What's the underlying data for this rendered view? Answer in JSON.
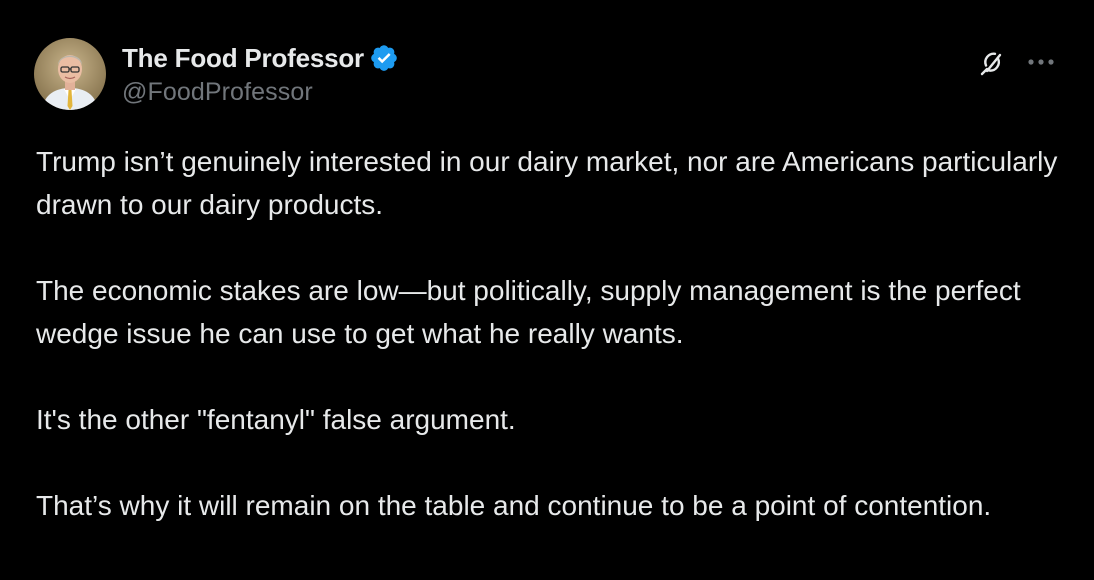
{
  "author": {
    "display_name": "The Food Professor",
    "handle": "@FoodProfessor",
    "verified": true,
    "verified_color": "#1d9bf0"
  },
  "actions": {
    "grok_icon": "grok-icon",
    "more_icon": "more-horizontal-icon"
  },
  "tweet": {
    "paragraphs": [
      "Trump isn’t genuinely interested in our dairy market, nor are Americans particularly drawn to our dairy products.",
      "The economic stakes are low—but politically, supply management is the perfect wedge issue he can use to get what he really wants.",
      "It's the other \"fentanyl\" false argument.",
      "That’s why it will remain on the table and continue to be a point of contention."
    ]
  },
  "colors": {
    "background": "#000000",
    "text_primary": "#e7e9ea",
    "text_secondary": "#71767b"
  }
}
